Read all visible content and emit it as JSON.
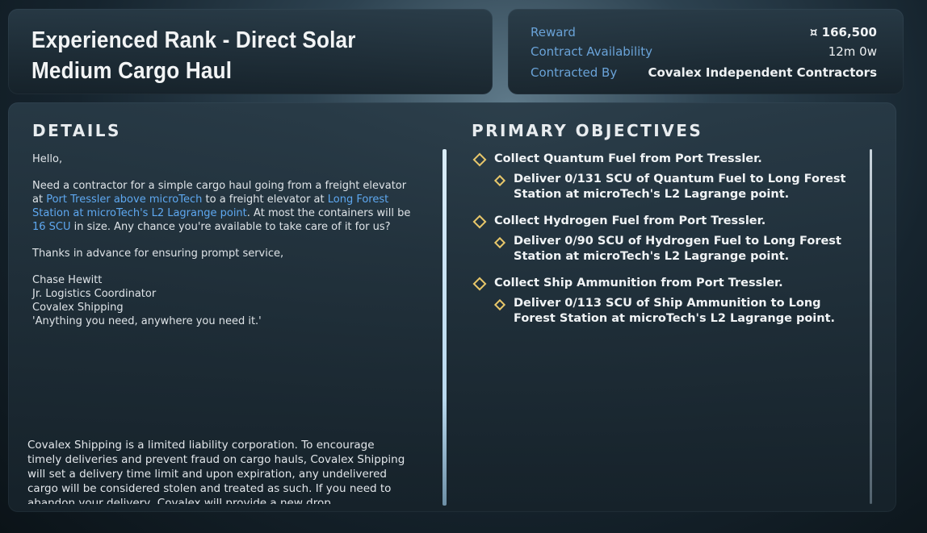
{
  "header": {
    "title": "Experienced Rank - Direct Solar Medium Cargo Haul"
  },
  "info": {
    "reward_label": "Reward",
    "reward_value": "¤ 166,500",
    "availability_label": "Contract Availability",
    "availability_value": "12m 0w",
    "contracted_by_label": "Contracted By",
    "contracted_by_value": "Covalex Independent Contractors"
  },
  "details": {
    "heading": "DETAILS",
    "greeting": "Hello,",
    "body_part1": "Need a contractor for a simple cargo haul going from a freight elevator at ",
    "origin": "Port Tressler above microTech",
    "body_part2": " to a freight elevator at ",
    "destination": "Long Forest Station at microTech's L2 Lagrange point",
    "body_part3": ". At most the containers will be ",
    "container_size": "16 SCU",
    "body_part4": " in size. Any chance you're available to take care of it for us?",
    "thanks": "Thanks in advance for ensuring prompt service,",
    "signature": [
      "Chase Hewitt",
      "Jr. Logistics Coordinator",
      "Covalex Shipping",
      "'Anything you need, anywhere you need it.'"
    ],
    "fine_print": "Covalex Shipping is a limited liability corporation. To encourage timely deliveries and prevent fraud on cargo hauls, Covalex Shipping will set a delivery time limit and upon expiration, any undelivered cargo will be considered stolen and treated as such. If you need to abandon your delivery, Covalex will provide a new drop"
  },
  "objectives": {
    "heading": "PRIMARY OBJECTIVES",
    "items": [
      {
        "primary": "Collect Quantum Fuel from Port Tressler.",
        "sub": "Deliver 0/131 SCU of Quantum Fuel to Long Forest Station at microTech's L2 Lagrange point."
      },
      {
        "primary": "Collect Hydrogen Fuel from Port Tressler.",
        "sub": "Deliver 0/90 SCU of Hydrogen Fuel to Long Forest Station at microTech's L2 Lagrange point."
      },
      {
        "primary": "Collect Ship Ammunition from Port Tressler.",
        "sub": "Deliver 0/113 SCU of Ship Ammunition to Long Forest Station at microTech's L2 Lagrange point."
      }
    ]
  },
  "colors": {
    "accent_link": "#5ea8f0",
    "label_blue": "#6aa3d8",
    "objective_marker": "#e8c76a"
  },
  "icons": {
    "objective_marker": "diamond-icon"
  }
}
